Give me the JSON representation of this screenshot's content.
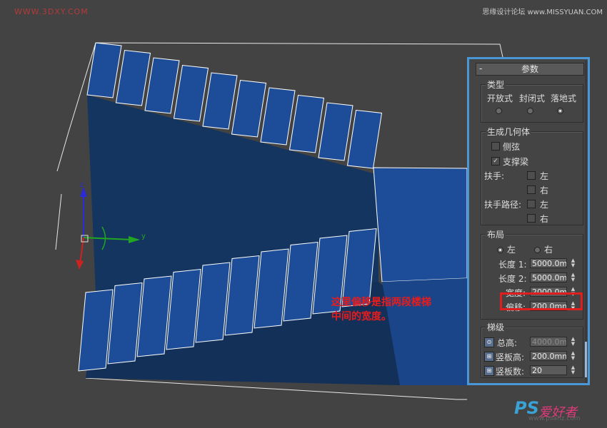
{
  "watermarks": {
    "top_left": "WWW.3DXY.COM",
    "top_right": "思缘设计论坛 www.MISSYUAN.COM",
    "bottom_right_ps": "PS",
    "bottom_right_cn": "爱好者",
    "bottom_right_url": "www.psahz.com"
  },
  "annotation": {
    "line1": "这里偏移是指两段楼梯",
    "line2": "中间的宽度。"
  },
  "viewport": {
    "axis_z": "z",
    "axis_y": "y",
    "axis_x": "x",
    "colors": {
      "background": "#434343",
      "stair_face": "#1d4d98",
      "stair_side": "#143563",
      "edge": "#ffffff"
    }
  },
  "panel": {
    "rollout_title": "参数",
    "rollout_toggle": "-",
    "type_group": {
      "title": "类型",
      "options": [
        "开放式",
        "封闭式",
        "落地式"
      ],
      "selected": "落地式"
    },
    "geometry_group": {
      "title": "生成几何体",
      "stringers_label": "侧弦",
      "stringers_checked": false,
      "carriage_label": "支撑梁",
      "carriage_checked": true,
      "handrail_label": "扶手:",
      "handrail_path_label": "扶手路径:",
      "left_label": "左",
      "right_label": "右"
    },
    "layout_group": {
      "title": "布局",
      "left_label": "左",
      "right_label": "右",
      "selected": "左",
      "length1_label": "长度 1:",
      "length1_value": "5000.0mm",
      "length2_label": "长度 2:",
      "length2_value": "5000.0mm",
      "width_label": "宽度:",
      "width_value": "2000.0mm",
      "offset_label": "偏移:",
      "offset_value": "200.0mm"
    },
    "steps_group": {
      "title": "梯级",
      "overall_label": "总高:",
      "overall_value": "4000.0mm",
      "riser_height_label": "竖板高:",
      "riser_height_value": "200.0mm",
      "riser_count_label": "竖板数:",
      "riser_count_value": "20"
    }
  }
}
